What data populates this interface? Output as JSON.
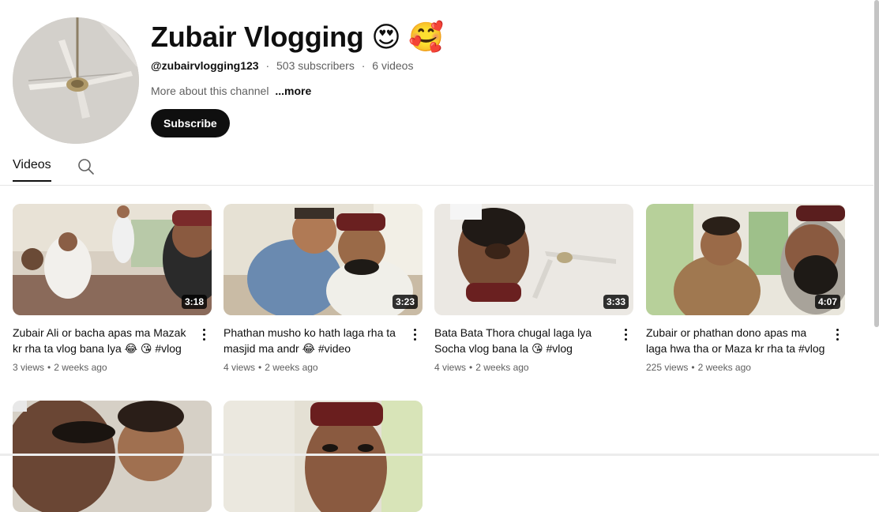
{
  "channel": {
    "name": "Zubair Vlogging",
    "name_emojis": "😍 🥰",
    "handle": "@zubairvlogging123",
    "subscribers": "503 subscribers",
    "video_count": "6 videos",
    "about": "More about this channel",
    "more": "...more",
    "subscribe_label": "Subscribe"
  },
  "tabs": [
    {
      "label": "Videos",
      "active": true
    }
  ],
  "videos": [
    {
      "title": "Zubair Ali or bacha apas ma Mazak kr rha ta vlog bana lya 😂 😘 #vlog",
      "views": "3 views",
      "age": "2 weeks ago",
      "duration": "3:18"
    },
    {
      "title": "Phathan musho ko hath laga rha ta masjid ma andr 😂 #video",
      "views": "4 views",
      "age": "2 weeks ago",
      "duration": "3:23"
    },
    {
      "title": "Bata Bata Thora chugal laga lya Socha vlog bana la 😘 #vlog",
      "views": "4 views",
      "age": "2 weeks ago",
      "duration": "3:33"
    },
    {
      "title": "Zubair or phathan dono apas ma laga hwa tha or Maza kr rha ta #vlog",
      "views": "225 views",
      "age": "2 weeks ago",
      "duration": "4:07"
    },
    {
      "title": "",
      "views": "",
      "age": "",
      "duration": ""
    },
    {
      "title": "",
      "views": "",
      "age": "",
      "duration": ""
    }
  ],
  "icons": {
    "search": "search-icon",
    "more_actions": "more-vert-icon"
  },
  "colors": {
    "text": "#0f0f0f",
    "secondary_text": "#606060",
    "subscribe_bg": "#0f0f0f",
    "subscribe_text": "#ffffff",
    "duration_bg": "#000000cc"
  }
}
